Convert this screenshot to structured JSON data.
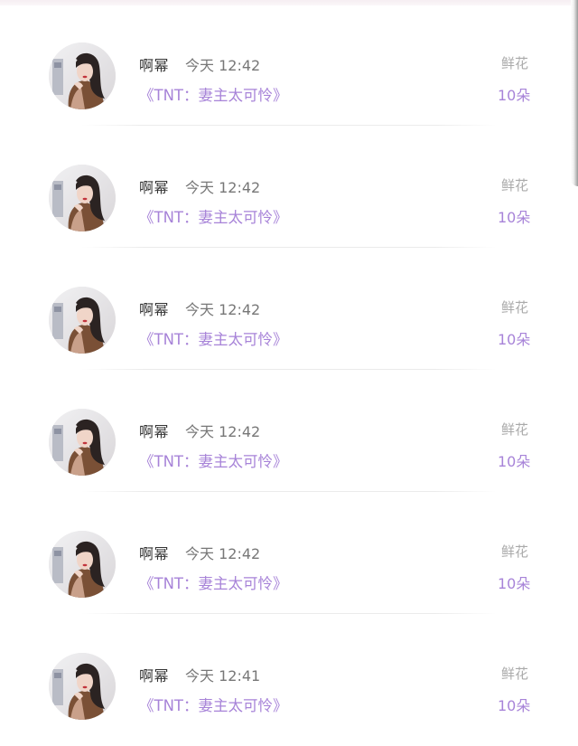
{
  "colors": {
    "accent_purple": "#a783d8",
    "name_text": "#333333",
    "time_text": "#777777",
    "label_gray": "#aaaaaa"
  },
  "records": [
    {
      "user": "啊幂",
      "time": "今天 12:42",
      "book": "《TNT：妻主太可怜》",
      "gift_type": "鲜花",
      "gift_count": "10朵",
      "avatar_icon": "user-avatar-photo"
    },
    {
      "user": "啊幂",
      "time": "今天 12:42",
      "book": "《TNT：妻主太可怜》",
      "gift_type": "鲜花",
      "gift_count": "10朵",
      "avatar_icon": "user-avatar-photo"
    },
    {
      "user": "啊幂",
      "time": "今天 12:42",
      "book": "《TNT：妻主太可怜》",
      "gift_type": "鲜花",
      "gift_count": "10朵",
      "avatar_icon": "user-avatar-photo"
    },
    {
      "user": "啊幂",
      "time": "今天 12:42",
      "book": "《TNT：妻主太可怜》",
      "gift_type": "鲜花",
      "gift_count": "10朵",
      "avatar_icon": "user-avatar-photo"
    },
    {
      "user": "啊幂",
      "time": "今天 12:42",
      "book": "《TNT：妻主太可怜》",
      "gift_type": "鲜花",
      "gift_count": "10朵",
      "avatar_icon": "user-avatar-photo"
    },
    {
      "user": "啊幂",
      "time": "今天 12:41",
      "book": "《TNT：妻主太可怜》",
      "gift_type": "鲜花",
      "gift_count": "10朵",
      "avatar_icon": "user-avatar-photo"
    }
  ]
}
